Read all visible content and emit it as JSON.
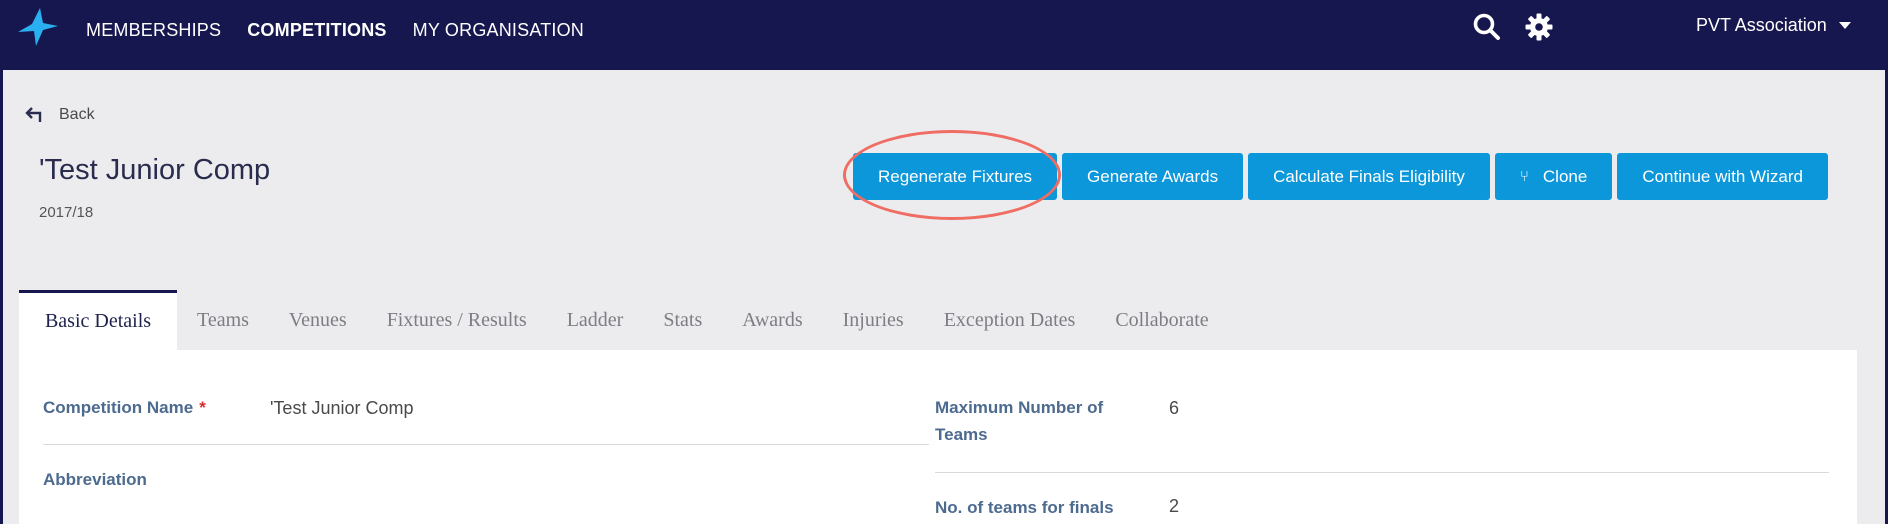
{
  "header": {
    "nav": [
      {
        "label": "MEMBERSHIPS",
        "active": false
      },
      {
        "label": "COMPETITIONS",
        "active": true
      },
      {
        "label": "MY ORGANISATION",
        "active": false
      }
    ],
    "icons": [
      "search-icon",
      "gear-icon"
    ],
    "org_name": "PVT Association"
  },
  "page": {
    "back_label": "Back",
    "title": "'Test Junior Comp",
    "season": "2017/18"
  },
  "actions": {
    "regenerate": "Regenerate Fixtures",
    "awards": "Generate Awards",
    "finals": "Calculate Finals Eligibility",
    "clone": "Clone",
    "wizard": "Continue with Wizard"
  },
  "tabs": [
    "Basic Details",
    "Teams",
    "Venues",
    "Fixtures / Results",
    "Ladder",
    "Stats",
    "Awards",
    "Injuries",
    "Exception Dates",
    "Collaborate"
  ],
  "fields": {
    "competition_name_label": "Competition Name",
    "required_marker": "*",
    "competition_name_value": "'Test Junior Comp",
    "abbreviation_label": "Abbreviation",
    "max_teams_label_line1": "Maximum Number of",
    "max_teams_label_line2": "Teams",
    "max_teams_value": "6",
    "finals_teams_label": "No. of teams for finals",
    "finals_teams_value": "2"
  },
  "colors": {
    "navbar": "#16174f",
    "button": "#0b97d9",
    "highlight": "#ef6d62",
    "label": "#4d6a8f"
  }
}
